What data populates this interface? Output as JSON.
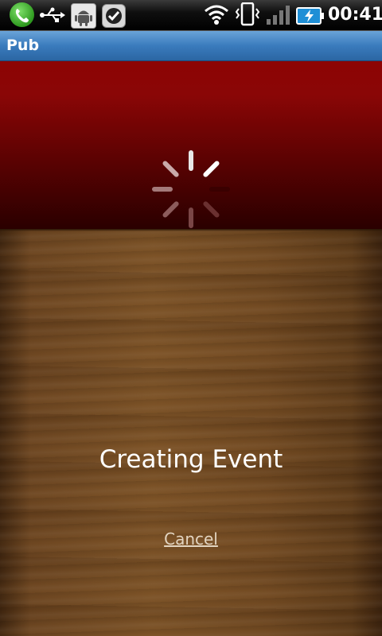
{
  "status_bar": {
    "time": "00:41",
    "icons": [
      "phone-icon",
      "usb-icon",
      "android-icon",
      "check-icon",
      "wifi-icon",
      "vibrate-icon",
      "signal-icon",
      "battery-icon"
    ]
  },
  "app": {
    "title": "Pub"
  },
  "loading": {
    "message": "Creating Event",
    "cancel_label": "Cancel"
  },
  "colors": {
    "title_bar": "#3a7bbd",
    "banner_red": "#8d0404",
    "wood": "#6a4420"
  }
}
